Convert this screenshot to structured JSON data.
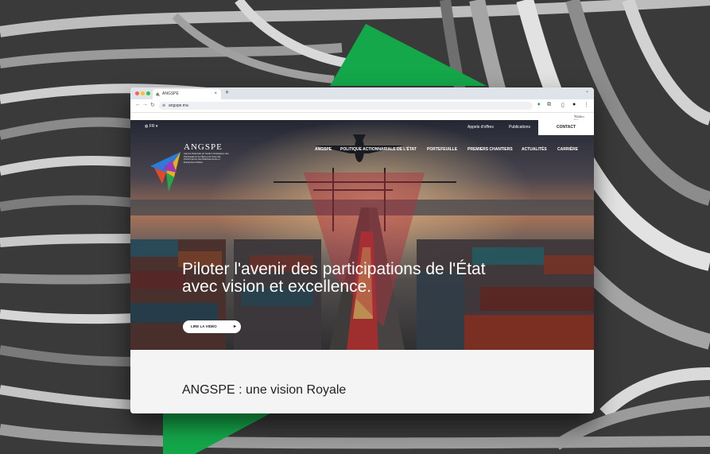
{
  "browser": {
    "tab_title": "ANGSPE",
    "tab_close": "×",
    "new_tab": "+",
    "url": "angspe.ma",
    "bookmarks_label": "Tous les favoris"
  },
  "site": {
    "language": "FR",
    "top_links": [
      "Appels d'offres",
      "Publications"
    ],
    "contact": "CONTACT",
    "logo_name": "ANGSPE",
    "logo_subtitle": "Agence Nationale de Gestion Stratégique des Participations de l'État et de Suivi des Performances des Établissements et Entreprises Publics",
    "nav": [
      "ANGSPE",
      "POLITIQUE ACTIONNARIALE DE L'ÉTAT",
      "PORTEFEUILLE",
      "PREMIERS CHANTIERS",
      "ACTUALITÉS",
      "CARRIÈRE"
    ],
    "headline": "Piloter l'avenir des participations de l'État avec vision et excellence.",
    "video_button": "LIRE LA VIDÉO",
    "section_title": "ANGSPE : une vision Royale"
  },
  "colors": {
    "accent_green": "#14a84a",
    "overlay_red": "#d63a4a",
    "tab_bar": "#dfe3ea"
  },
  "icons": [
    "back-arrow-icon",
    "forward-arrow-icon",
    "reload-icon",
    "site-info-icon",
    "extension-icon",
    "sidebar-icon",
    "profile-icon",
    "menu-icon",
    "globe-icon",
    "play-icon",
    "folder-icon"
  ]
}
